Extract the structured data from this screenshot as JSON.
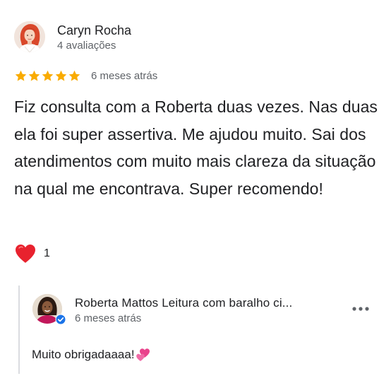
{
  "review": {
    "reviewer_name": "Caryn Rocha",
    "reviewer_reviews_count": "4 avaliações",
    "rating": 5,
    "rating_max": 5,
    "date": "6 meses atrás",
    "text": "Fiz consulta com a Roberta duas vezes. Nas duas ela foi super assertiva. Me ajudou muito. Sai dos atendimentos com muito mais clareza da situação na qual me encontrava. Super recomendo!",
    "reaction_icon": "heart-icon",
    "reaction_count": "1",
    "star_color": "#f9ab00",
    "heart_color": "#e8222e"
  },
  "owner_reply": {
    "name": "Roberta Mattos Leitura com baralho ci...",
    "date": "6 meses atrás",
    "text": "Muito obrigadaaaa!",
    "emoji_icon": "two-hearts-icon",
    "verified_icon": "verified-badge-icon",
    "more_icon": "more-options-icon",
    "accent_color": "#1a73e8"
  }
}
